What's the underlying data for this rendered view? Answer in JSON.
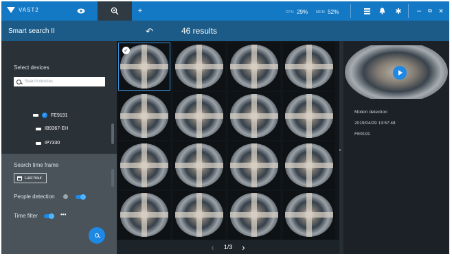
{
  "app": {
    "brand": "VAST2"
  },
  "topbar": {
    "tabs": [
      {
        "icon": "eye-icon",
        "active": false
      },
      {
        "icon": "smart-search-icon",
        "active": true
      },
      {
        "icon": "plus-icon",
        "active": false
      }
    ],
    "cpu": {
      "label": "CPU",
      "value": "29%"
    },
    "memory": {
      "label": "MEM",
      "value": "52%"
    },
    "actions": [
      "grid-icon",
      "bell-icon",
      "gear-icon"
    ],
    "window_controls": [
      "minimize-icon",
      "restore-icon",
      "close-icon"
    ]
  },
  "header": {
    "title": "Smart search II",
    "results": "46 results"
  },
  "left_panel": {
    "select_devices_label": "Select devices",
    "search_placeholder": "Search devices",
    "devices": [
      {
        "name": "FE9191",
        "checked": true
      },
      {
        "name": "IB9367-EH",
        "checked": false
      },
      {
        "name": "IP7330",
        "checked": false
      }
    ],
    "search_time_frame_label": "Search time frame",
    "time_button_label": "Last hour",
    "people_detection_label": "People detection",
    "people_detection_on": true,
    "time_filter_label": "Time filter",
    "time_filter_on": true
  },
  "results_grid": {
    "rows": 4,
    "cols": 4,
    "selected_index": 0
  },
  "pagination": {
    "label": "1/3",
    "current": 1,
    "total": 3
  },
  "detail": {
    "event_type": "Motion detection",
    "timestamp": "2019/04/29 13:57:48",
    "device": "FE9191"
  }
}
